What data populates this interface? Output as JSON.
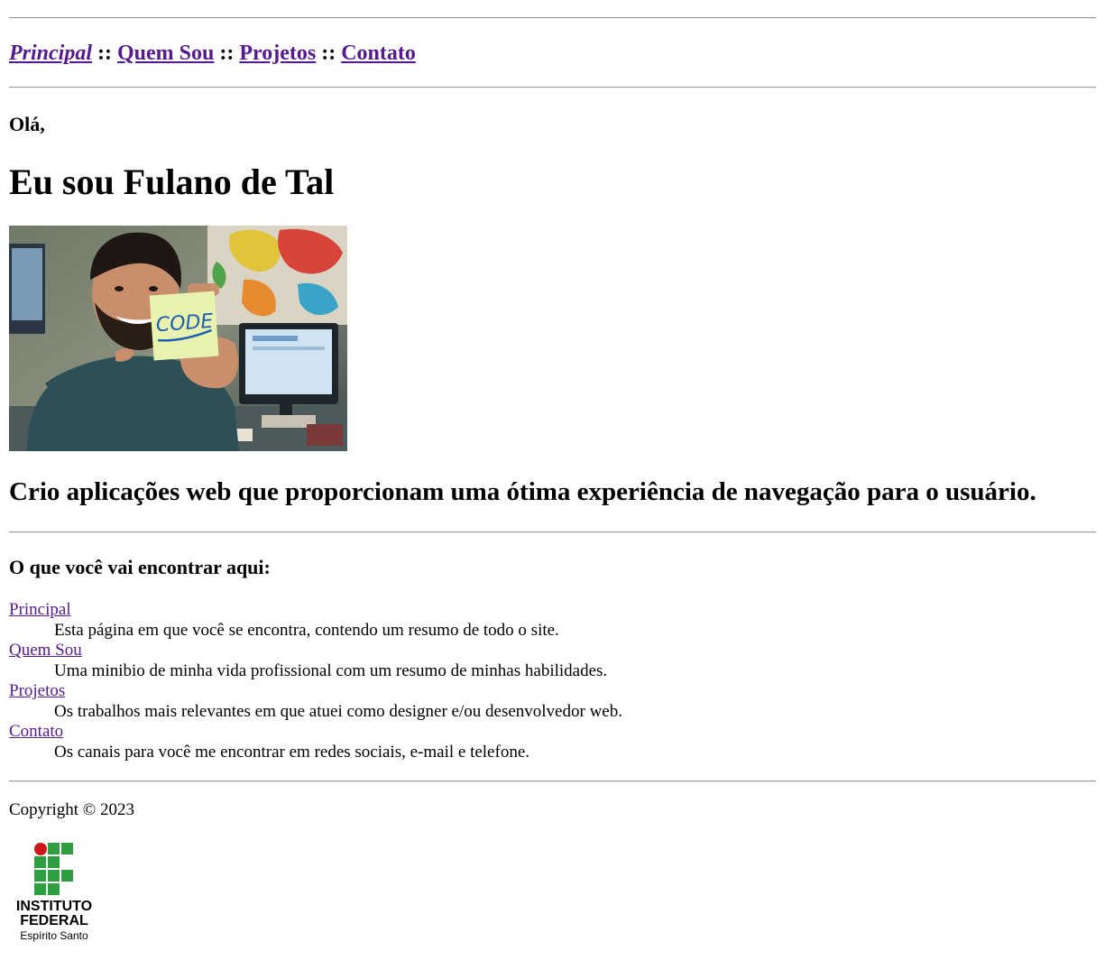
{
  "nav": {
    "items": [
      "Principal",
      "Quem Sou",
      "Projetos",
      "Contato"
    ],
    "separator": "::"
  },
  "hero": {
    "greeting": "Olá,",
    "title": "Eu sou Fulano de Tal",
    "photo_note_text": "CODE",
    "tagline": "Crio aplicações web que proporcionam uma ótima experiência de navegação para o usuário."
  },
  "section": {
    "heading": "O que você vai encontrar aqui:",
    "items": [
      {
        "term": "Principal",
        "description": "Esta página em que você se encontra, contendo um resumo de todo o site."
      },
      {
        "term": "Quem Sou",
        "description": "Uma minibio de minha vida profissional com um resumo de minhas habilidades."
      },
      {
        "term": "Projetos",
        "description": "Os trabalhos mais relevantes em que atuei como designer e/ou desenvolvedor web."
      },
      {
        "term": "Contato",
        "description": "Os canais para você me encontrar em redes sociais, e-mail e telefone."
      }
    ]
  },
  "footer": {
    "copyright": "Copyright © 2023",
    "logo": {
      "line1": "INSTITUTO",
      "line2": "FEDERAL",
      "line3": "Espírito Santo",
      "green": "#2f9e41",
      "red": "#cd191e"
    }
  },
  "colors": {
    "link": "#551a8b",
    "rule": "#9a9a9a"
  }
}
